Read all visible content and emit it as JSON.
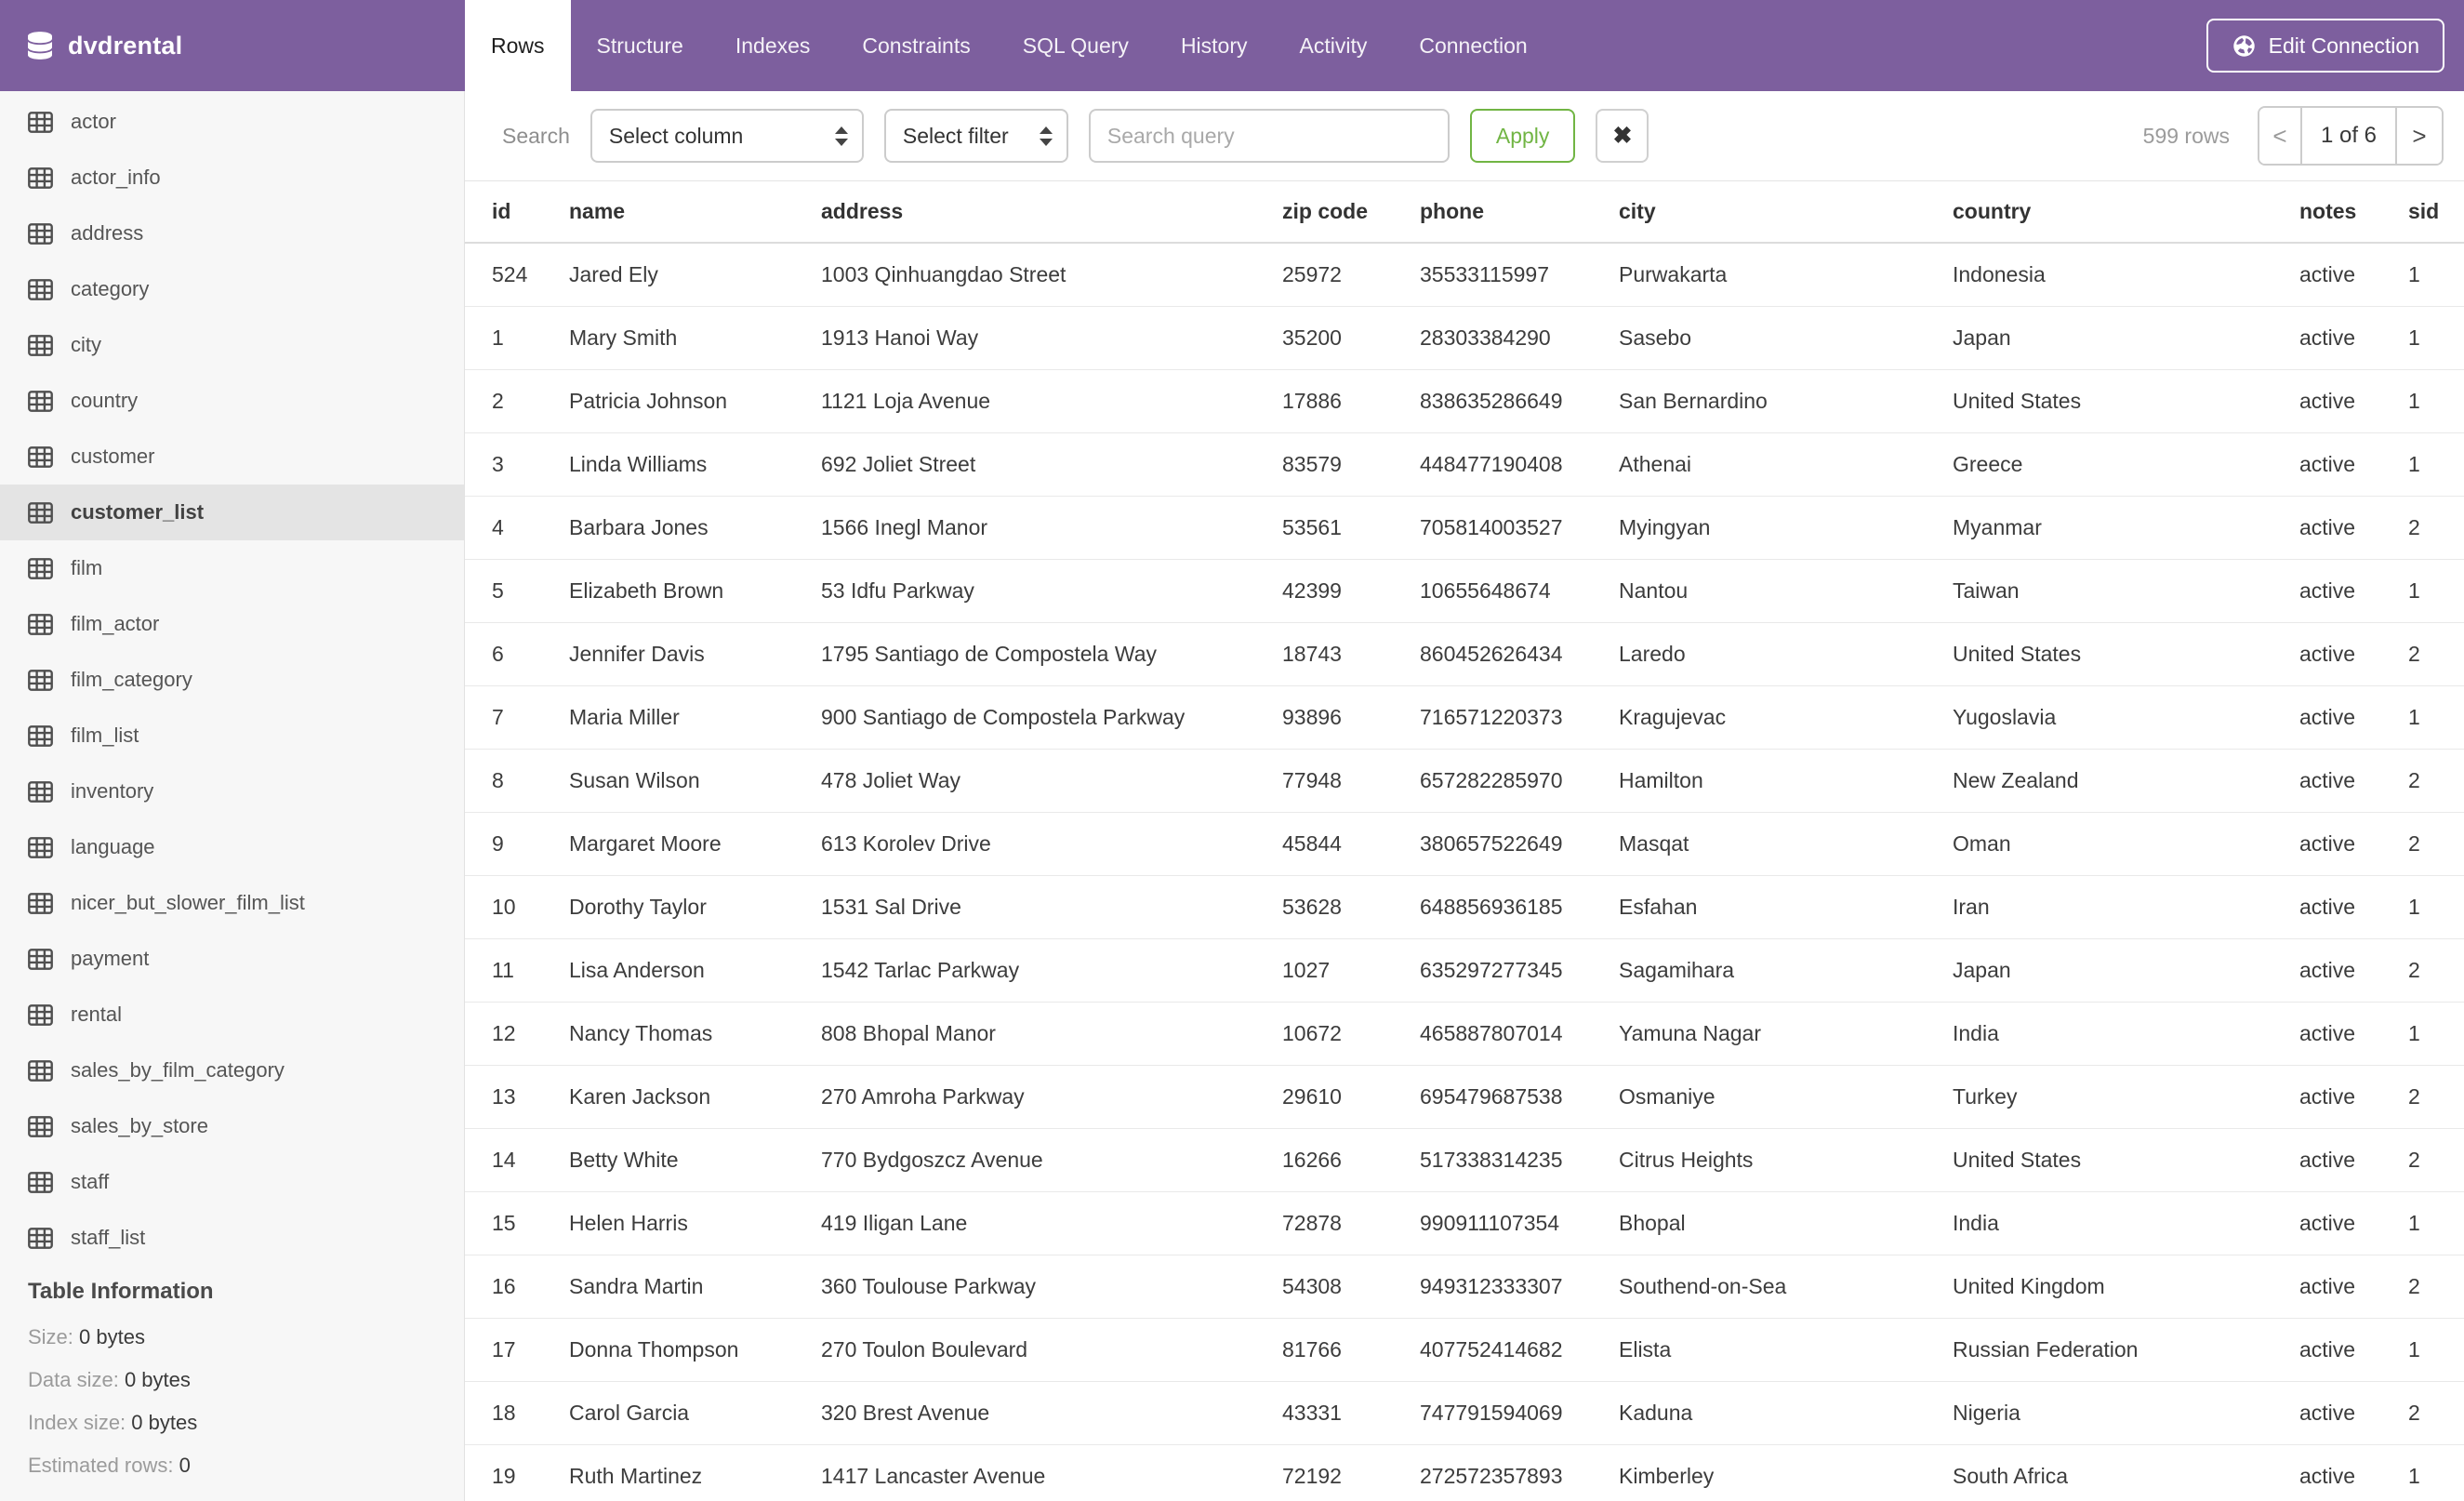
{
  "colors": {
    "brand-purple": "#7D5F9E",
    "accent-green": "#71B544",
    "sidebar-bg": "#F7F7F7",
    "selected-bg": "#E4E4E4",
    "control-border": "#CCCCCC",
    "row-border": "#E9E9E9",
    "header-border": "#DCDCDC",
    "text-dark": "#3C3C3C",
    "text-gray": "#999999"
  },
  "app": {
    "database_name": "dvdrental",
    "edit_connection_label": "Edit Connection"
  },
  "nav": {
    "tabs": [
      {
        "label": "Rows",
        "active": true
      },
      {
        "label": "Structure",
        "active": false
      },
      {
        "label": "Indexes",
        "active": false
      },
      {
        "label": "Constraints",
        "active": false
      },
      {
        "label": "SQL Query",
        "active": false
      },
      {
        "label": "History",
        "active": false
      },
      {
        "label": "Activity",
        "active": false
      },
      {
        "label": "Connection",
        "active": false
      }
    ]
  },
  "sidebar": {
    "tables": [
      "actor",
      "actor_info",
      "address",
      "category",
      "city",
      "country",
      "customer",
      "customer_list",
      "film",
      "film_actor",
      "film_category",
      "film_list",
      "inventory",
      "language",
      "nicer_but_slower_film_list",
      "payment",
      "rental",
      "sales_by_film_category",
      "sales_by_store",
      "staff",
      "staff_list"
    ],
    "selected": "customer_list",
    "info": {
      "heading": "Table Information",
      "rows": [
        {
          "label": "Size:",
          "value": "0 bytes"
        },
        {
          "label": "Data size:",
          "value": "0 bytes"
        },
        {
          "label": "Index size:",
          "value": "0 bytes"
        },
        {
          "label": "Estimated rows:",
          "value": "0"
        }
      ]
    }
  },
  "toolbar": {
    "search_label": "Search",
    "column_select": "Select column",
    "filter_select": "Select filter",
    "query_placeholder": "Search query",
    "query_value": "",
    "apply_label": "Apply",
    "clear_icon": "✖",
    "rows_count": "599 rows",
    "pagination": {
      "prev": "<",
      "current": "1 of 6",
      "next": ">"
    }
  },
  "grid": {
    "columns": [
      "id",
      "name",
      "address",
      "zip code",
      "phone",
      "city",
      "country",
      "notes",
      "sid"
    ],
    "rows": [
      [
        "524",
        "Jared Ely",
        "1003 Qinhuangdao Street",
        "25972",
        "35533115997",
        "Purwakarta",
        "Indonesia",
        "active",
        "1"
      ],
      [
        "1",
        "Mary Smith",
        "1913 Hanoi Way",
        "35200",
        "28303384290",
        "Sasebo",
        "Japan",
        "active",
        "1"
      ],
      [
        "2",
        "Patricia Johnson",
        "1121 Loja Avenue",
        "17886",
        "838635286649",
        "San Bernardino",
        "United States",
        "active",
        "1"
      ],
      [
        "3",
        "Linda Williams",
        "692 Joliet Street",
        "83579",
        "448477190408",
        "Athenai",
        "Greece",
        "active",
        "1"
      ],
      [
        "4",
        "Barbara Jones",
        "1566 Inegl Manor",
        "53561",
        "705814003527",
        "Myingyan",
        "Myanmar",
        "active",
        "2"
      ],
      [
        "5",
        "Elizabeth Brown",
        "53 Idfu Parkway",
        "42399",
        "10655648674",
        "Nantou",
        "Taiwan",
        "active",
        "1"
      ],
      [
        "6",
        "Jennifer Davis",
        "1795 Santiago de Compostela Way",
        "18743",
        "860452626434",
        "Laredo",
        "United States",
        "active",
        "2"
      ],
      [
        "7",
        "Maria Miller",
        "900 Santiago de Compostela Parkway",
        "93896",
        "716571220373",
        "Kragujevac",
        "Yugoslavia",
        "active",
        "1"
      ],
      [
        "8",
        "Susan Wilson",
        "478 Joliet Way",
        "77948",
        "657282285970",
        "Hamilton",
        "New Zealand",
        "active",
        "2"
      ],
      [
        "9",
        "Margaret Moore",
        "613 Korolev Drive",
        "45844",
        "380657522649",
        "Masqat",
        "Oman",
        "active",
        "2"
      ],
      [
        "10",
        "Dorothy Taylor",
        "1531 Sal Drive",
        "53628",
        "648856936185",
        "Esfahan",
        "Iran",
        "active",
        "1"
      ],
      [
        "11",
        "Lisa Anderson",
        "1542 Tarlac Parkway",
        "1027",
        "635297277345",
        "Sagamihara",
        "Japan",
        "active",
        "2"
      ],
      [
        "12",
        "Nancy Thomas",
        "808 Bhopal Manor",
        "10672",
        "465887807014",
        "Yamuna Nagar",
        "India",
        "active",
        "1"
      ],
      [
        "13",
        "Karen Jackson",
        "270 Amroha Parkway",
        "29610",
        "695479687538",
        "Osmaniye",
        "Turkey",
        "active",
        "2"
      ],
      [
        "14",
        "Betty White",
        "770 Bydgoszcz Avenue",
        "16266",
        "517338314235",
        "Citrus Heights",
        "United States",
        "active",
        "2"
      ],
      [
        "15",
        "Helen Harris",
        "419 Iligan Lane",
        "72878",
        "990911107354",
        "Bhopal",
        "India",
        "active",
        "1"
      ],
      [
        "16",
        "Sandra Martin",
        "360 Toulouse Parkway",
        "54308",
        "949312333307",
        "Southend-on-Sea",
        "United Kingdom",
        "active",
        "2"
      ],
      [
        "17",
        "Donna Thompson",
        "270 Toulon Boulevard",
        "81766",
        "407752414682",
        "Elista",
        "Russian Federation",
        "active",
        "1"
      ],
      [
        "18",
        "Carol Garcia",
        "320 Brest Avenue",
        "43331",
        "747791594069",
        "Kaduna",
        "Nigeria",
        "active",
        "2"
      ],
      [
        "19",
        "Ruth Martinez",
        "1417 Lancaster Avenue",
        "72192",
        "272572357893",
        "Kimberley",
        "South Africa",
        "active",
        "1"
      ]
    ]
  }
}
